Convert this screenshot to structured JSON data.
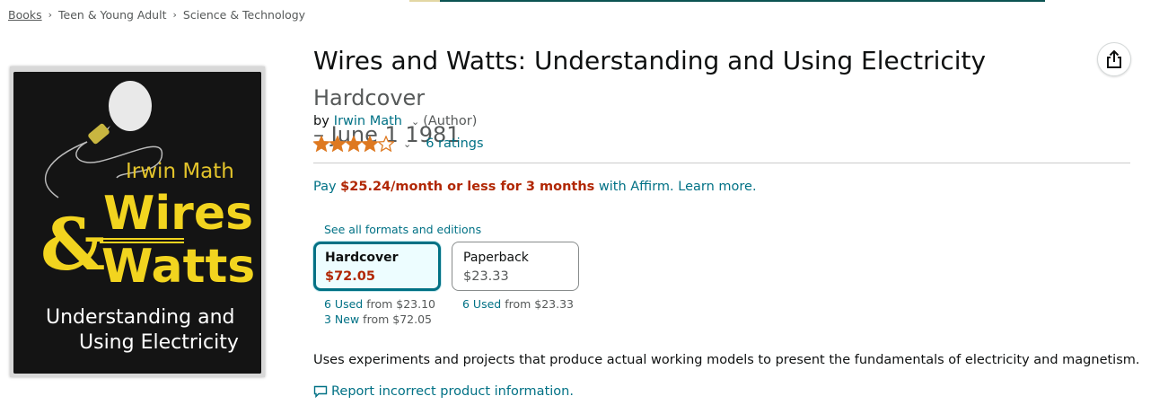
{
  "breadcrumb": [
    "Books",
    "Teen & Young Adult",
    "Science & Technology"
  ],
  "product": {
    "title": "Wires and Watts: Understanding and Using Electricity",
    "format": "Hardcover",
    "date": "– June 1 1981",
    "by_label": "by",
    "author": "Irwin Math",
    "author_role": "(Author)",
    "rating_value": 4,
    "rating_max": 5,
    "ratings_count": "6 ratings"
  },
  "cover": {
    "author_text": "Irwin Math",
    "title_line1": "Wires",
    "title_amp": "&",
    "title_line2": "Watts",
    "subtitle_line1": "Understanding and",
    "subtitle_line2": "Using Electricity"
  },
  "affirm": {
    "prefix": "Pay",
    "price": "$25.24/month or less for 3 months",
    "suffix": "with Affirm. Learn more."
  },
  "formats": {
    "see_all": "See all formats and editions",
    "items": [
      {
        "name": "Hardcover",
        "price": "$72.05",
        "offers": [
          {
            "link": "6 Used",
            "rest": " from $23.10"
          },
          {
            "link": "3 New",
            "rest": " from $72.05"
          }
        ]
      },
      {
        "name": "Paperback",
        "price": "$23.33",
        "offers": [
          {
            "link": "6 Used",
            "rest": " from $23.33"
          }
        ]
      }
    ]
  },
  "description": "Uses experiments and projects that produce actual working models to present the fundamentals of electricity and magnetism.",
  "report_link": "Report incorrect product information.",
  "colors": {
    "link": "#007185",
    "price": "#b12704",
    "star": "#de7921",
    "selected_border": "#007185"
  }
}
